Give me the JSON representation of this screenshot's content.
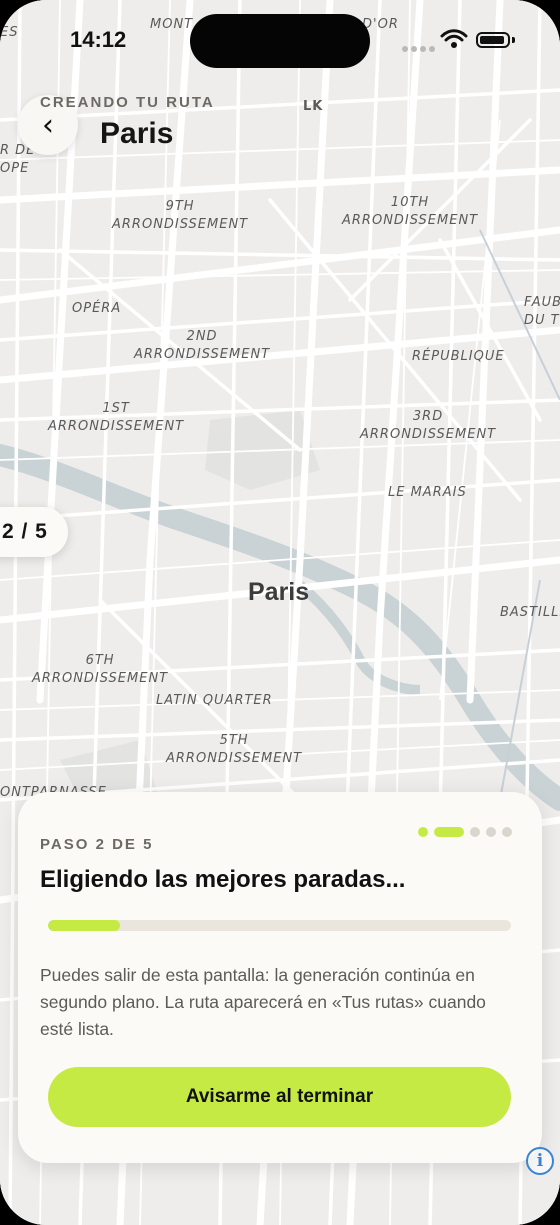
{
  "status_bar": {
    "time": "14:12"
  },
  "header": {
    "eyebrow": "CREANDO TU RUTA",
    "title": "Paris",
    "back_icon": "chevron-left-icon"
  },
  "map": {
    "city_label": "Paris",
    "labels": {
      "montmartre": "MONT",
      "dor": "D'OR",
      "es": "ES",
      "lk": "LK",
      "rde": "R DE\nOPE",
      "ninth": "9TH\nARRONDISSEMENT",
      "tenth": "10TH\nARRONDISSEMENT",
      "faub": "FAUB\nDU T",
      "opera": "OPÉRA",
      "second": "2ND\nARRONDISSEMENT",
      "republique": "RÉPUBLIQUE",
      "first": "1ST\nARRONDISSEMENT",
      "third": "3RD\nARRONDISSEMENT",
      "marais": "LE MARAIS",
      "bastille": "BASTILLE",
      "sixth": "6TH\nARRONDISSEMENT",
      "latin": "LATIN QUARTER",
      "fifth": "5TH\nARRONDISSEMENT",
      "montparnasse": "ONTPARNASSE"
    }
  },
  "step_pill": {
    "label": "2 / 5"
  },
  "progress_card": {
    "eyebrow": "PASO 2 DE 5",
    "title": "Eligiendo las mejores paradas...",
    "progress_fraction": 0.155,
    "steps_total": 5,
    "step_current": 2,
    "body": "Puedes salir de esta pantalla: la generación continúa en segundo plano. La ruta aparecerá en «Tus rutas» cuando esté lista.",
    "cta_label": "Avisarme al terminar"
  },
  "info_button": {
    "icon": "info-icon",
    "glyph": "i"
  },
  "colors": {
    "accent": "#c6ea44",
    "map_bg": "#ecebe9",
    "river": "#c9d2d4",
    "card_bg": "#fbfaf6"
  }
}
